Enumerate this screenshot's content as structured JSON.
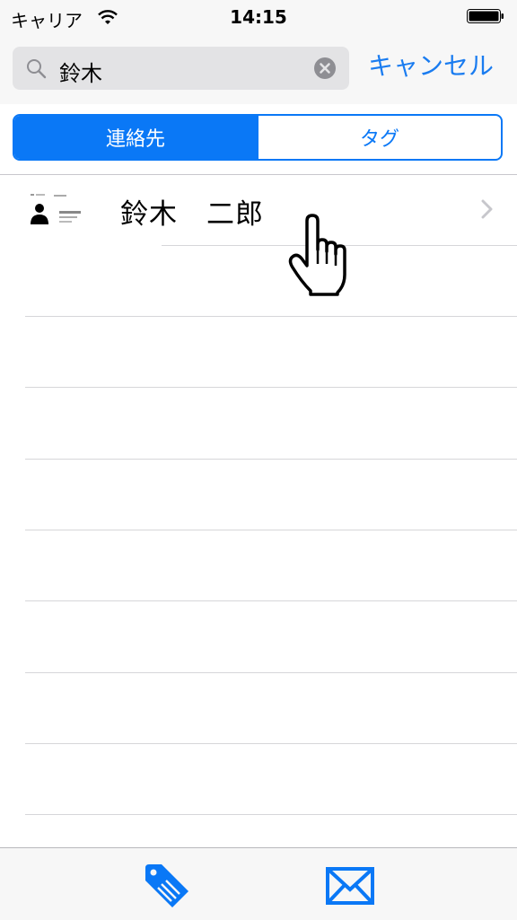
{
  "status_bar": {
    "carrier": "キャリア",
    "time": "14:15",
    "icons": [
      "wifi-icon",
      "battery-icon"
    ]
  },
  "search": {
    "value": "鈴木",
    "cancel_label": "キャンセル",
    "icons": [
      "search-icon",
      "clear-icon"
    ]
  },
  "segments": [
    {
      "label": "連絡先",
      "selected": true
    },
    {
      "label": "タグ",
      "selected": false
    }
  ],
  "results": [
    {
      "name": "鈴木　二郎",
      "icons": [
        "business-card-avatar-icon",
        "chevron-right-icon"
      ]
    }
  ],
  "overlay": {
    "icon": "pointing-hand-cursor-icon"
  },
  "tab_bar": {
    "icons": [
      "tag-icon",
      "mail-icon"
    ]
  },
  "colors": {
    "accent": "#0a78f6",
    "background": "#ffffff",
    "bar_background": "#f7f7f7",
    "search_field": "#e3e3e5"
  }
}
